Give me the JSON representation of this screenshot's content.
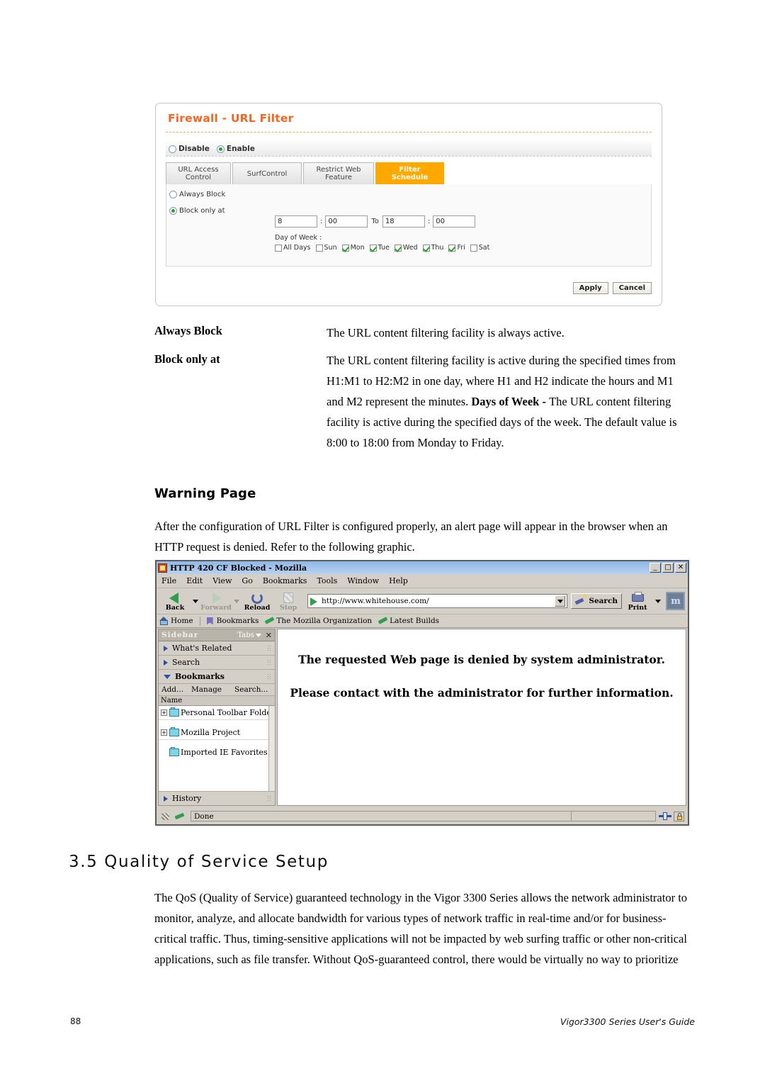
{
  "router_panel": {
    "title": "Firewall - URL Filter",
    "mode_radios": [
      {
        "label": "Disable",
        "selected": false
      },
      {
        "label": "Enable",
        "selected": true
      }
    ],
    "tabs": [
      {
        "label": "URL Access\nControl",
        "active": false
      },
      {
        "label": "SurfControl",
        "active": false
      },
      {
        "label": "Restrict Web\nFeature",
        "active": false
      },
      {
        "label": "Filter Schedule",
        "active": true
      }
    ],
    "schedule_radios": [
      {
        "label": "Always Block",
        "selected": false
      },
      {
        "label": "Block only at",
        "selected": true
      }
    ],
    "time": {
      "start_hour": "8",
      "start_minute": "00",
      "to_label": "To",
      "end_hour": "18",
      "end_minute": "00",
      "separator": ":"
    },
    "day_of_week_label": "Day of Week :",
    "days": [
      {
        "label": "All Days",
        "checked": false
      },
      {
        "label": "Sun",
        "checked": false
      },
      {
        "label": "Mon",
        "checked": true
      },
      {
        "label": "Tue",
        "checked": true
      },
      {
        "label": "Wed",
        "checked": true
      },
      {
        "label": "Thu",
        "checked": true
      },
      {
        "label": "Fri",
        "checked": true
      },
      {
        "label": "Sat",
        "checked": false
      }
    ],
    "buttons": {
      "apply": "Apply",
      "cancel": "Cancel"
    },
    "accent_color": "#f26522",
    "active_tab_color": "#ffa800"
  },
  "definitions": [
    {
      "term": "Always Block",
      "body": "The URL content filtering facility is always active."
    },
    {
      "term": "Block only at",
      "body_part1": "The URL content filtering facility is active during the specified times from H1:M1 to H2:M2 in one day, where H1 and H2 indicate the hours and M1 and M2 represent the minutes. ",
      "body_bold": "Days of Week - ",
      "body_part2": "The URL content filtering facility is active during the specified days of the week. The default value is 8:00 to 18:00 from Monday to Friday."
    }
  ],
  "warning_section": {
    "heading": "Warning Page",
    "paragraph": "After the configuration of URL Filter is configured properly, an alert page will appear in the browser when an HTTP request is denied. Refer to the following graphic."
  },
  "browser": {
    "title": "HTTP 420 CF Blocked - Mozilla",
    "window_buttons": {
      "minimize": "_",
      "maximize": "□",
      "close": "✕"
    },
    "menu": [
      "File",
      "Edit",
      "View",
      "Go",
      "Bookmarks",
      "Tools",
      "Window",
      "Help"
    ],
    "toolbar": {
      "back": "Back",
      "forward": "Forward",
      "reload": "Reload",
      "stop": "Stop",
      "search": "Search",
      "print": "Print",
      "logo": "m"
    },
    "url": "http://www.whitehouse.com/",
    "bookmarks_bar": [
      "Home",
      "Bookmarks",
      "The Mozilla Organization",
      "Latest Builds"
    ],
    "sidebar": {
      "title": "Sidebar",
      "tabs_label": "Tabs",
      "close_label": "✕",
      "sections": [
        {
          "label": "What's Related",
          "open": false
        },
        {
          "label": "Search",
          "open": false
        },
        {
          "label": "Bookmarks",
          "open": true
        }
      ],
      "bookmarks_toolbar": [
        "Add...",
        "Manage",
        "Search..."
      ],
      "column_header": "Name",
      "tree": [
        {
          "label": "Personal Toolbar Folder",
          "expandable": true
        },
        {
          "label": "Mozilla Project",
          "expandable": true
        },
        {
          "label": "Imported IE Favorites",
          "expandable": false
        }
      ],
      "history_label": "History"
    },
    "page": {
      "line1": "The requested Web page is denied by system administrator.",
      "line2": "Please contact with the administrator for further information."
    },
    "status": "Done"
  },
  "qos_section": {
    "heading": "3.5 Quality of Service Setup",
    "paragraph": "The QoS (Quality of Service) guaranteed technology in the Vigor 3300 Series allows the network administrator to monitor, analyze, and allocate bandwidth for various types of network traffic in real-time and/or for business-critical traffic. Thus, timing-sensitive applications will not be impacted by web surfing traffic or other non-critical applications, such as file transfer. Without QoS-guaranteed control, there would be virtually no way to prioritize"
  },
  "footer": {
    "page_number": "88",
    "guide_title": "Vigor3300 Series User's Guide"
  }
}
